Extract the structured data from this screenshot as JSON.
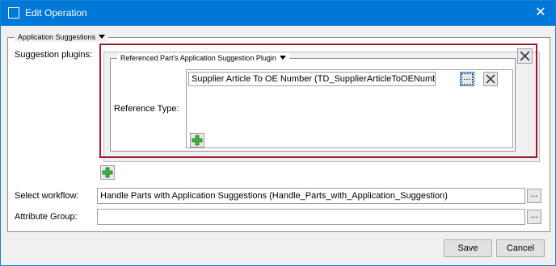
{
  "window": {
    "title": "Edit Operation",
    "accent": "#0078d7",
    "highlight_color": "#a4162b"
  },
  "application_suggestions": {
    "legend": "Application Suggestions",
    "suggestion_plugins_label": "Suggestion plugins:",
    "plugin": {
      "legend": "Referenced Part's Application Suggestion Plugin",
      "reference_type_label": "Reference Type:",
      "reference_value": "Supplier Article To OE Number (TD_SupplierArticleToOENumber)",
      "browse_label": "..."
    }
  },
  "workflow": {
    "label": "Select workflow:",
    "value": "Handle Parts with Application Suggestions (Handle_Parts_with_Application_Suggestion)",
    "browse_label": "..."
  },
  "attribute_group": {
    "label": "Attribute Group:",
    "value": "",
    "browse_label": "..."
  },
  "footer": {
    "save_label": "Save",
    "cancel_label": "Cancel"
  },
  "icons": [
    "window-icon",
    "close-icon",
    "remove-icon",
    "add-icon",
    "dropdown-arrow-icon"
  ]
}
